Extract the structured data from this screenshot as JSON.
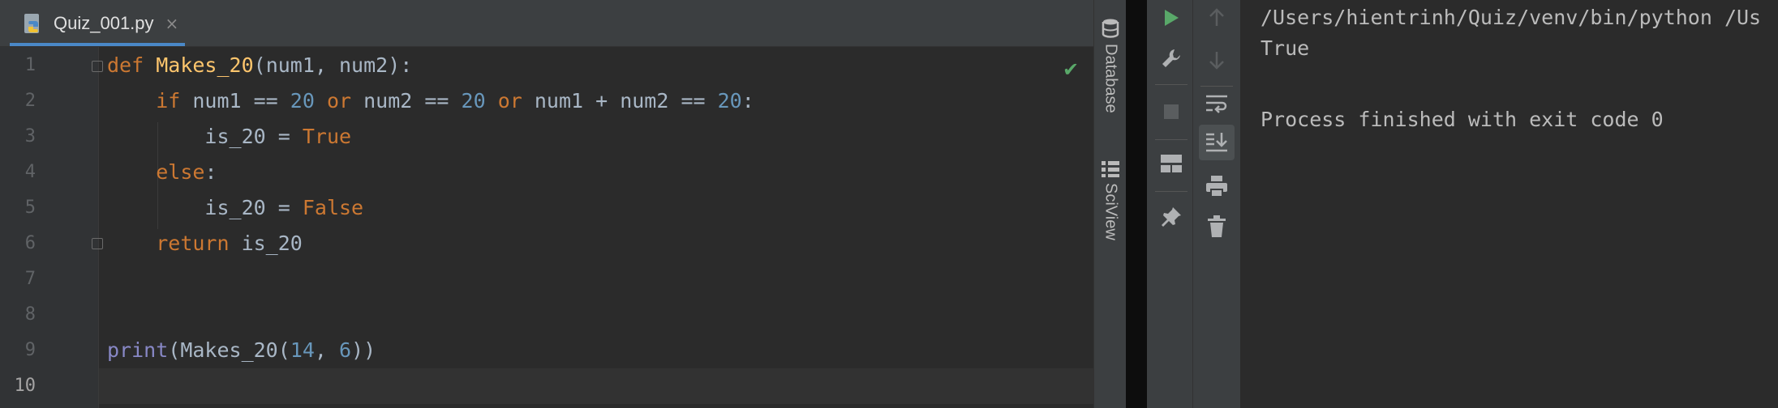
{
  "tab": {
    "file_name": "Quiz_001.py",
    "close_glyph": "×"
  },
  "gutter": {
    "line_numbers": [
      "1",
      "2",
      "3",
      "4",
      "5",
      "6",
      "7",
      "8",
      "9",
      "10"
    ]
  },
  "code": {
    "line1": {
      "def": "def",
      "space": " ",
      "fname": "Makes_20",
      "rest": "(num1, num2):"
    },
    "line2": {
      "indent": "    ",
      "if": "if",
      "a": " num1 == ",
      "n1": "20",
      "or1": " or",
      "b": " num2 == ",
      "n2": "20",
      "or2": " or",
      "c": " num1 + num2 == ",
      "n3": "20",
      "colon": ":"
    },
    "line3": {
      "indent": "        ",
      "var": "is_20 = ",
      "val": "True"
    },
    "line4": {
      "indent": "    ",
      "else": "else",
      "colon": ":"
    },
    "line5": {
      "indent": "        ",
      "var": "is_20 = ",
      "val": "False"
    },
    "line6": {
      "indent": "    ",
      "ret": "return",
      "var": " is_20"
    },
    "line9": {
      "print": "print",
      "open": "(",
      "fname": "Makes_20",
      "open2": "(",
      "n1": "14",
      "comma": ", ",
      "n2": "6",
      "close": "))"
    }
  },
  "inspection_status": "✔",
  "side_tools": {
    "database": "Database",
    "sciview": "SciView"
  },
  "console": {
    "command": "/Users/hientrinh/Quiz/venv/bin/python /Us",
    "output": "True",
    "exit_message": "Process finished with exit code 0"
  },
  "colors": {
    "keyword": "#cc7832",
    "function": "#ffc66d",
    "number": "#6897bb",
    "builtin": "#8888c6",
    "run_green": "#59a869"
  },
  "icons": [
    "python-file-icon",
    "database-icon",
    "sciview-icon",
    "run-icon",
    "wrench-icon",
    "stop-icon",
    "layout-icon",
    "pin-icon",
    "up-arrow-icon",
    "down-arrow-icon",
    "soft-wrap-icon",
    "scroll-to-end-icon",
    "print-icon",
    "trash-icon"
  ]
}
